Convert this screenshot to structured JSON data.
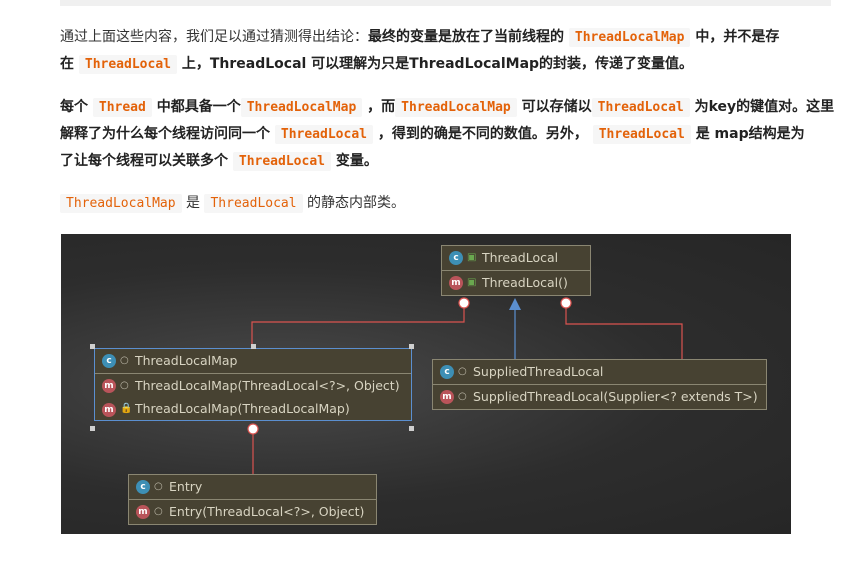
{
  "paragraphs": [
    {
      "line1_pre": "通过上面这些内容，我们足以通过猜测得出结论：",
      "line1_bold": "最终的变量是放在了当前线程的",
      "code1": "ThreadLocalMap",
      "line1_bold2": "中，并不是存",
      "line2_bold": "在",
      "code2": "ThreadLocal",
      "line2_bold2": "上，ThreadLocal 可以理解为只是ThreadLocalMap的封装，传递了变量值。"
    }
  ],
  "para2": {
    "t1": "每个",
    "c1": "Thread",
    "t2": "中都具备一个",
    "c2": "ThreadLocalMap",
    "t3": "，而",
    "c3": "ThreadLocalMap",
    "t4": "可以存储以",
    "c4": "ThreadLocal",
    "t5": "为key的键值对。这里",
    "t6": "解释了为什么每个线程访问同一个",
    "c5": "ThreadLocal",
    "t7": "，得到的确是不同的数值。另外，",
    "c6": "ThreadLocal",
    "t8": "是 map结构是为",
    "t9": "了让每个线程可以关联多个",
    "c7": "ThreadLocal",
    "t10": "变量。"
  },
  "para3": {
    "c1": "ThreadLocalMap",
    "t1": "是",
    "c2": "ThreadLocal",
    "t2": "的静态内部类。"
  },
  "diagram": {
    "threadlocal": {
      "title": "ThreadLocal",
      "method": "ThreadLocal()"
    },
    "threadlocalmap": {
      "title": "ThreadLocalMap",
      "method1": "ThreadLocalMap(ThreadLocal<?>, Object)",
      "method2": "ThreadLocalMap(ThreadLocalMap)"
    },
    "supplied": {
      "title": "SuppliedThreadLocal",
      "method": "SuppliedThreadLocal(Supplier<? extends T>)"
    },
    "entry": {
      "title": "Entry",
      "method": "Entry(ThreadLocal<?>, Object)"
    },
    "icon_class": "c",
    "icon_method": "m",
    "colors": {
      "inner_line": "#d9534f",
      "inherit_line": "#5b8fd0",
      "box_bg": "#474232"
    }
  }
}
